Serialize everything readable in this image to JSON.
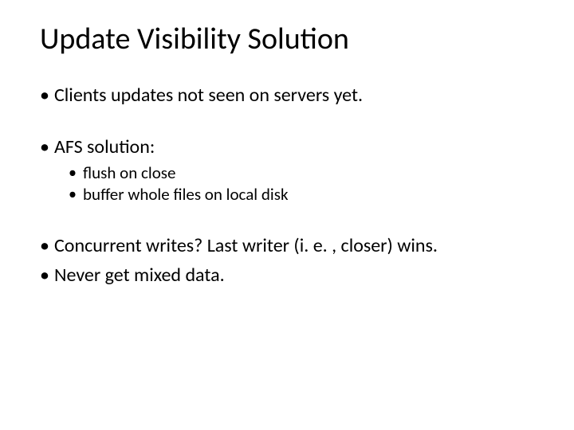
{
  "title": "Update Visibility Solution",
  "bullets": {
    "b0": "Clients updates not seen on servers yet.",
    "b1": "AFS solution:",
    "b1_sub": {
      "s0": "flush on close",
      "s1": "buffer whole files on local disk"
    },
    "b2": "Concurrent writes? Last writer (i. e. , closer) wins.",
    "b3": "Never get mixed data."
  }
}
